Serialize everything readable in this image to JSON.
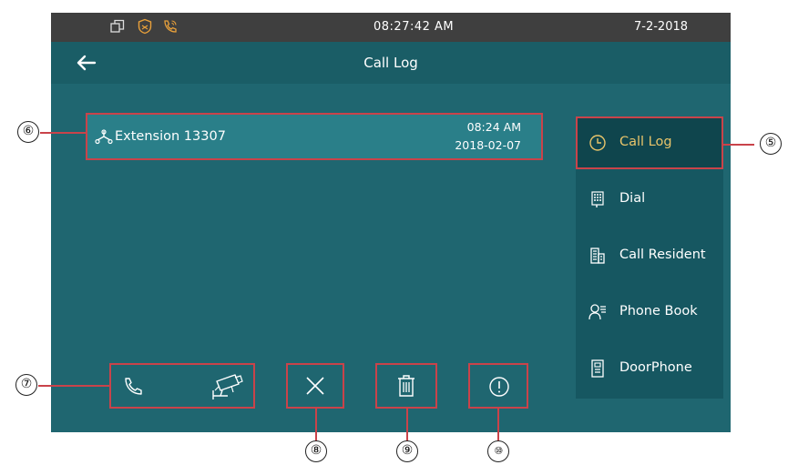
{
  "status": {
    "time": "08:27:42   AM",
    "date": "7-2-2018",
    "icons": [
      "window-icon",
      "shield-icon",
      "phone-call-icon"
    ]
  },
  "titlebar": {
    "title": "Call Log",
    "back_icon": "back-arrow-icon"
  },
  "call_log": {
    "entries": [
      {
        "name": "Extension 13307",
        "time": "08:24 AM",
        "date": "2018-02-07",
        "icon": "phone-extension-icon"
      }
    ]
  },
  "sidebar": {
    "items": [
      {
        "label": "Call Log",
        "icon": "clock-icon",
        "active": true
      },
      {
        "label": "Dial",
        "icon": "keypad-icon",
        "active": false
      },
      {
        "label": "Call Resident",
        "icon": "building-icon",
        "active": false
      },
      {
        "label": "Phone Book",
        "icon": "contacts-icon",
        "active": false
      },
      {
        "label": "DoorPhone",
        "icon": "doorphone-icon",
        "active": false
      }
    ]
  },
  "actions": {
    "call_icon": "phone-icon",
    "video_icon": "camera-icon",
    "cancel_icon": "close-icon",
    "delete_icon": "trash-icon",
    "info_icon": "info-icon"
  },
  "callouts": [
    "⑤",
    "⑥",
    "⑦",
    "⑧",
    "⑨",
    "⑩"
  ],
  "colors": {
    "accent": "#e8c46a",
    "background": "#1f6670",
    "highlight_border": "#c9434a",
    "statusbar": "#3f3f3f"
  }
}
